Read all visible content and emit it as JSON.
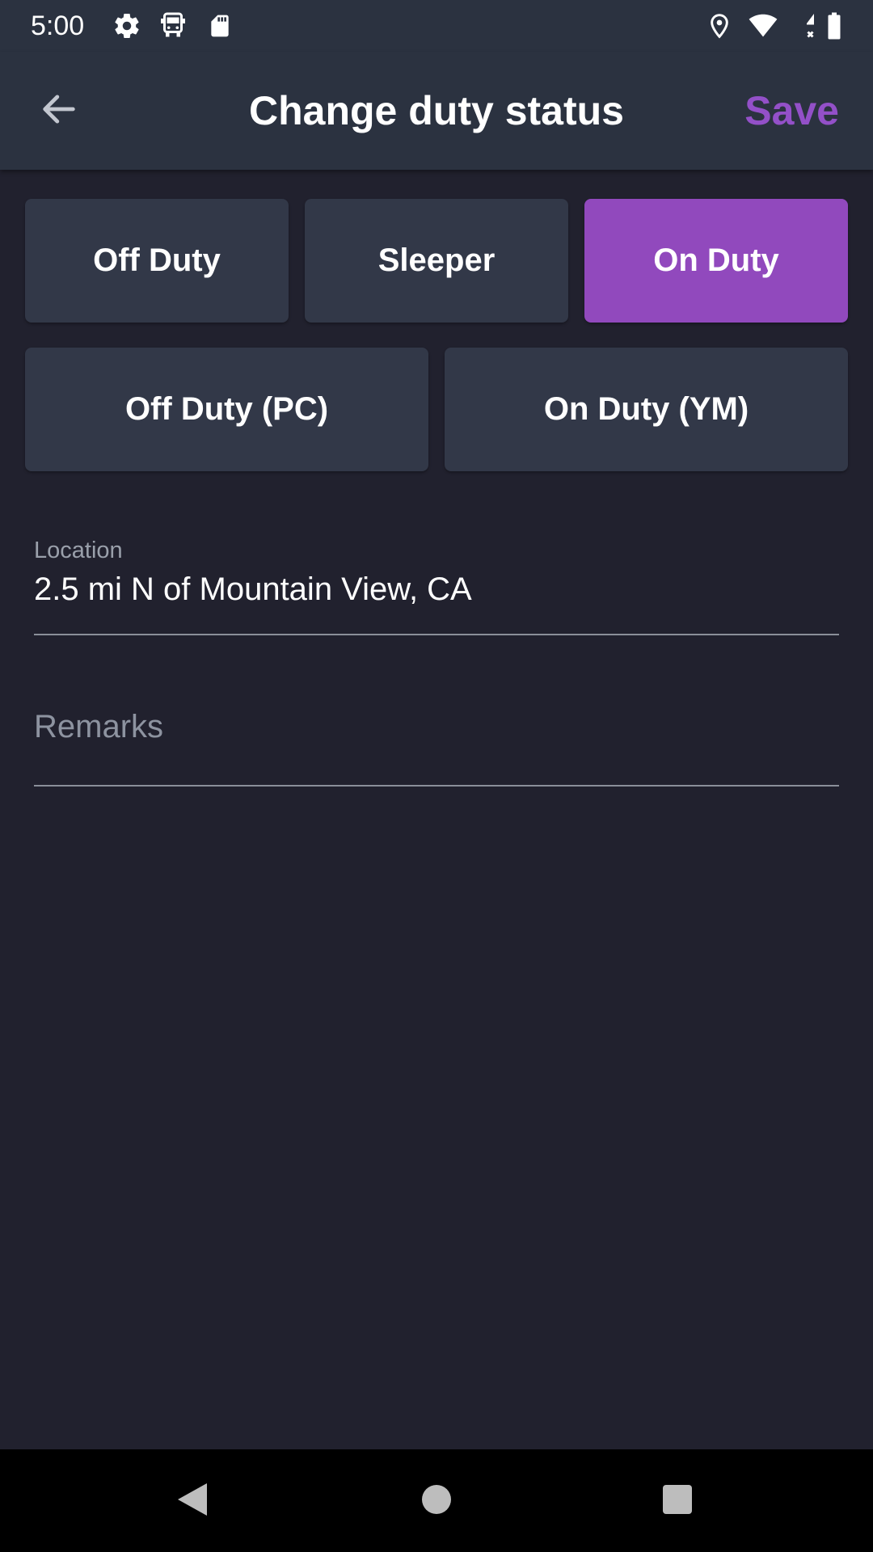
{
  "status_bar": {
    "time": "5:00",
    "icons": [
      "gear-icon",
      "bus-icon",
      "sd-card-icon",
      "location-pin-icon",
      "wifi-icon",
      "cell-signal-icon",
      "battery-icon"
    ]
  },
  "app_bar": {
    "back_icon": "arrow-left-icon",
    "title": "Change duty status",
    "save_label": "Save"
  },
  "duty_statuses": [
    {
      "label": "Off Duty",
      "selected": false
    },
    {
      "label": "Sleeper",
      "selected": false
    },
    {
      "label": "On Duty",
      "selected": true
    },
    {
      "label": "Off Duty (PC)",
      "selected": false
    },
    {
      "label": "On Duty (YM)",
      "selected": false
    }
  ],
  "location": {
    "label": "Location",
    "value": "2.5 mi N of Mountain View, CA"
  },
  "remarks": {
    "placeholder": "Remarks",
    "value": ""
  },
  "nav_bar": {
    "icons": [
      "back-triangle-icon",
      "home-circle-icon",
      "recents-square-icon"
    ]
  },
  "colors": {
    "accent": "#9149bd",
    "save_text": "#9350c8",
    "background": "#21212e",
    "appbar": "#2b3240",
    "button": "#323848"
  }
}
